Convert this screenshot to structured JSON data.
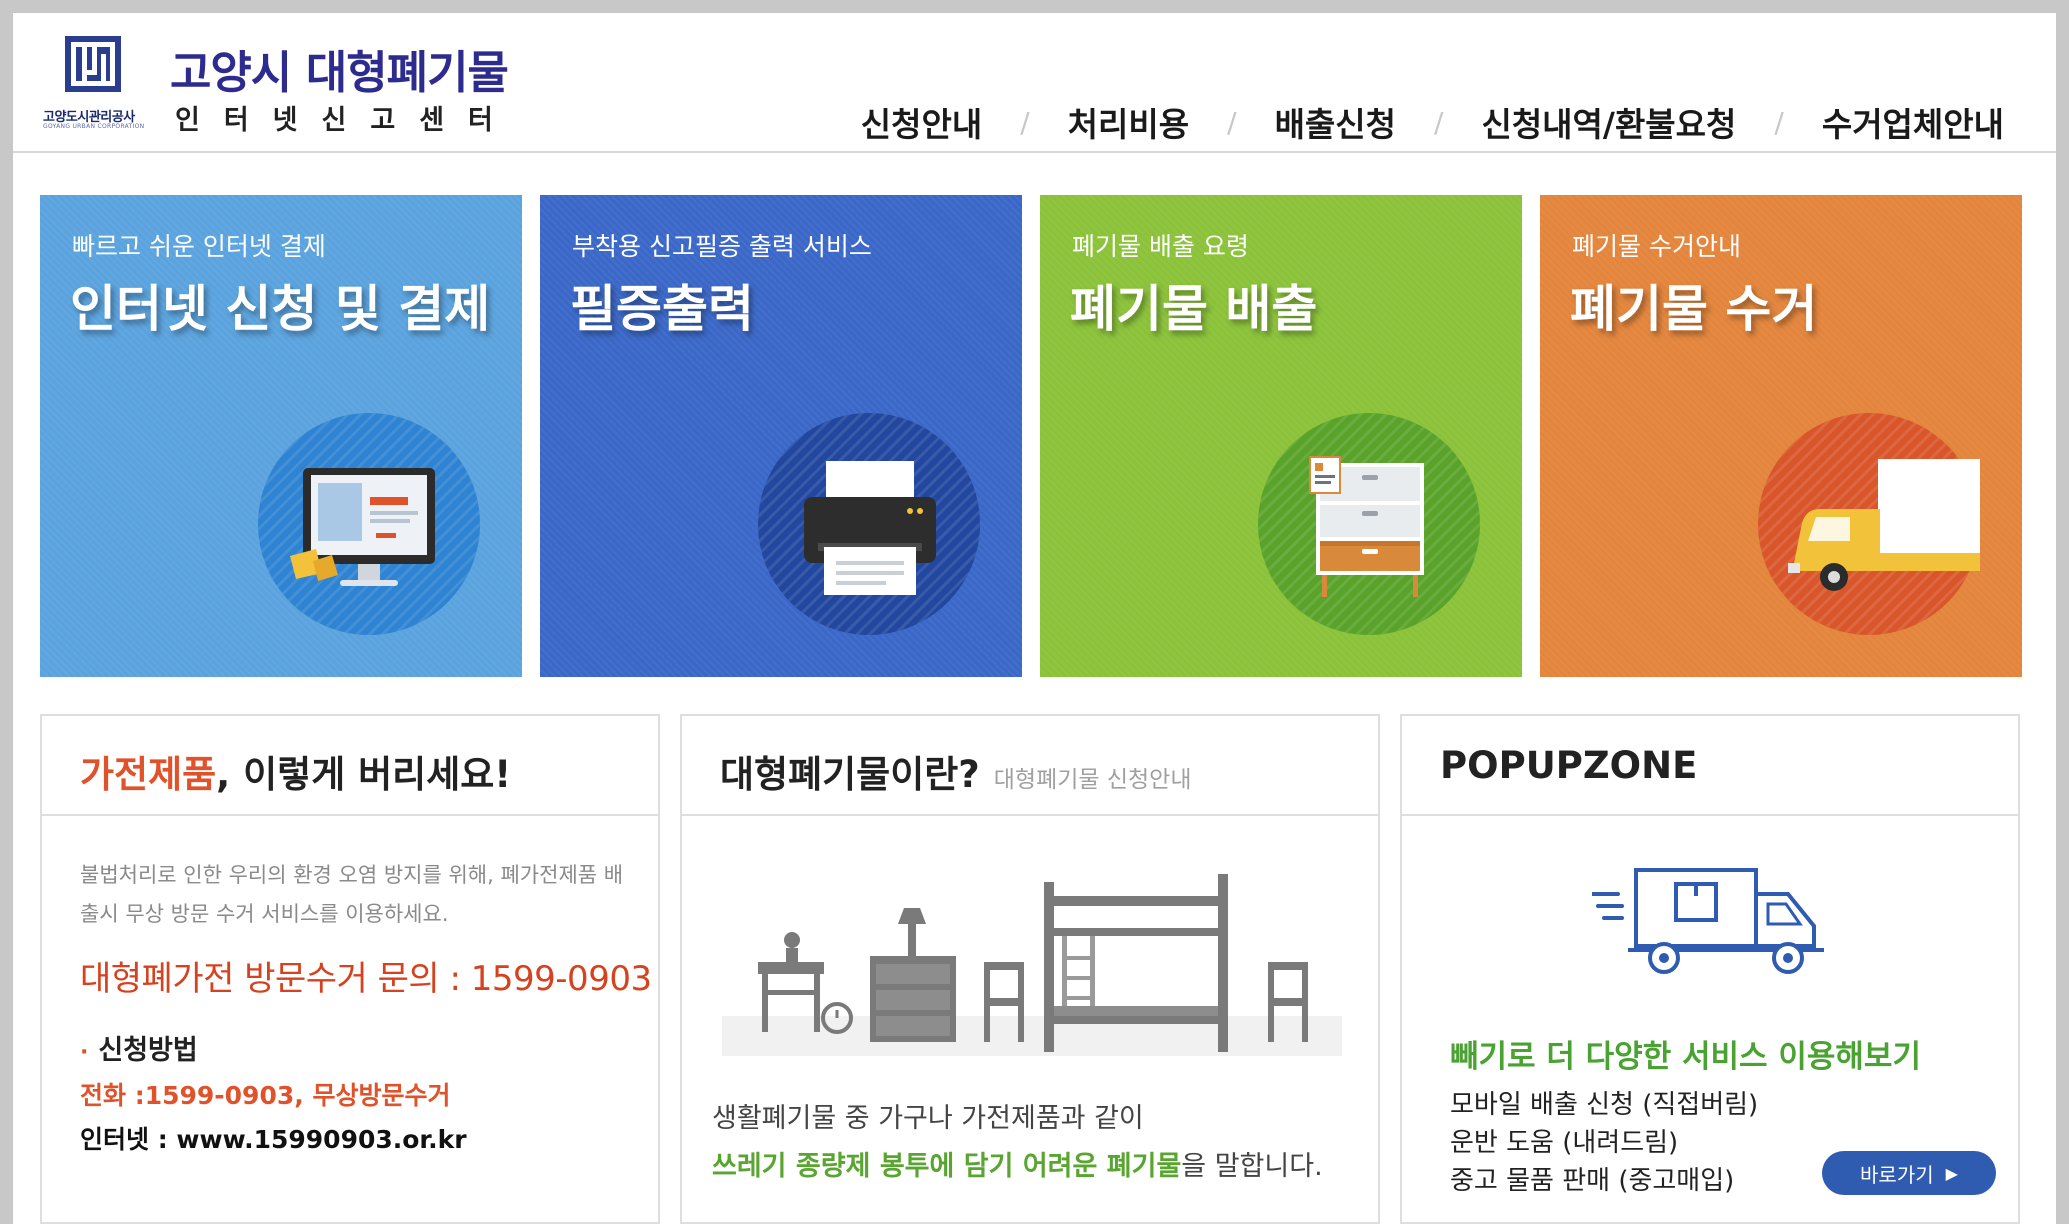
{
  "header": {
    "logo": {
      "title": "고양시 대형폐기물",
      "subtitle": "인터넷신고센터",
      "org": "고양도시관리공사",
      "org_en": "GOYANG URBAN CORPORATION"
    },
    "nav": [
      {
        "label": "신청안내"
      },
      {
        "label": "처리비용"
      },
      {
        "label": "배출신청"
      },
      {
        "label": "신청내역/환불요청"
      },
      {
        "label": "수거업체안내"
      }
    ],
    "separator": "/"
  },
  "tiles": [
    {
      "sub": "빠르고 쉬운 인터넷 결제",
      "title": "인터넷 신청 및 결제",
      "icon": "computer-monitor-icon"
    },
    {
      "sub": "부착용 신고필증 출력 서비스",
      "title": "필증출력",
      "icon": "printer-icon"
    },
    {
      "sub": "폐기물 배출 요령",
      "title": "폐기물 배출",
      "icon": "drawer-cabinet-icon"
    },
    {
      "sub": "폐기물 수거안내",
      "title": "폐기물 수거",
      "icon": "delivery-truck-icon"
    }
  ],
  "appliance_box": {
    "title_highlight": "가전제품",
    "title_rest": ", 이렇게 버리세요!",
    "description": "불법처리로 인한 우리의 환경 오염 방지를 위해, 폐가전제품 배출시 무상 방문 수거 서비스를 이용하세요.",
    "call": "대형폐가전 방문수거 문의 : 1599-0903",
    "method_bullet": "·",
    "method_label": "신청방법",
    "phone": "전화 :1599-0903, 무상방문수거",
    "web": "인터넷 : www.15990903.or.kr"
  },
  "waste_box": {
    "title": "대형폐기물이란?",
    "subtitle": "대형폐기물 신청안내",
    "line1": "생활폐기물 중 가구나 가전제품과 같이",
    "line2_highlight": "쓰레기 종량제 봉투에 담기 어려운 폐기물",
    "line2_rest": "을 말합니다."
  },
  "popup_box": {
    "title": "POPUPZONE",
    "headline": "빼기로 더 다양한 서비스 이용해보기",
    "items": [
      "모바일 배출 신청 (직접버림)",
      "운반 도움 (내려드림)",
      "중고 물품 판매 (중고매입)"
    ],
    "button": "바로가기",
    "button_arrow": "▶"
  },
  "colors": {
    "tile_blue_light": "#5ba3de",
    "tile_blue_dark": "#3b68c8",
    "tile_green": "#8bc23a",
    "tile_orange": "#e3853c",
    "accent_orange": "#e0522a",
    "accent_green": "#4aa233",
    "button_blue": "#2f5bb0"
  }
}
